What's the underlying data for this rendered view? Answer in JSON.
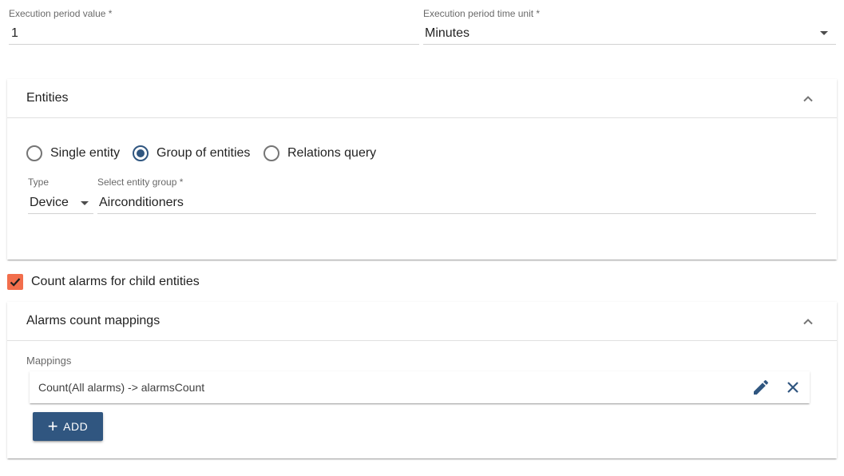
{
  "execution": {
    "period_value_label": "Execution period value *",
    "period_value": "1",
    "time_unit_label": "Execution period time unit *",
    "time_unit_value": "Minutes"
  },
  "entities": {
    "title": "Entities",
    "radio_options": [
      "Single entity",
      "Group of entities",
      "Relations query"
    ],
    "selected_option": "Group of entities",
    "type_label": "Type",
    "type_value": "Device",
    "group_label": "Select entity group *",
    "group_value": "Airconditioners"
  },
  "count_alarms": {
    "label": "Count alarms for child entities",
    "checked": true,
    "color": "#f26e4c"
  },
  "alarms_mappings": {
    "title": "Alarms count mappings",
    "mappings_label": "Mappings",
    "items": [
      "Count(All alarms) -> alarmsCount"
    ],
    "add_label": "ADD"
  },
  "colors": {
    "primary": "#305680",
    "accent": "#f26e4c"
  },
  "icons": {
    "edit": "pencil-icon",
    "delete": "close-icon",
    "collapse": "chevron-up-icon",
    "dropdown": "caret-down-icon",
    "check": "check-icon",
    "add": "plus-icon"
  }
}
